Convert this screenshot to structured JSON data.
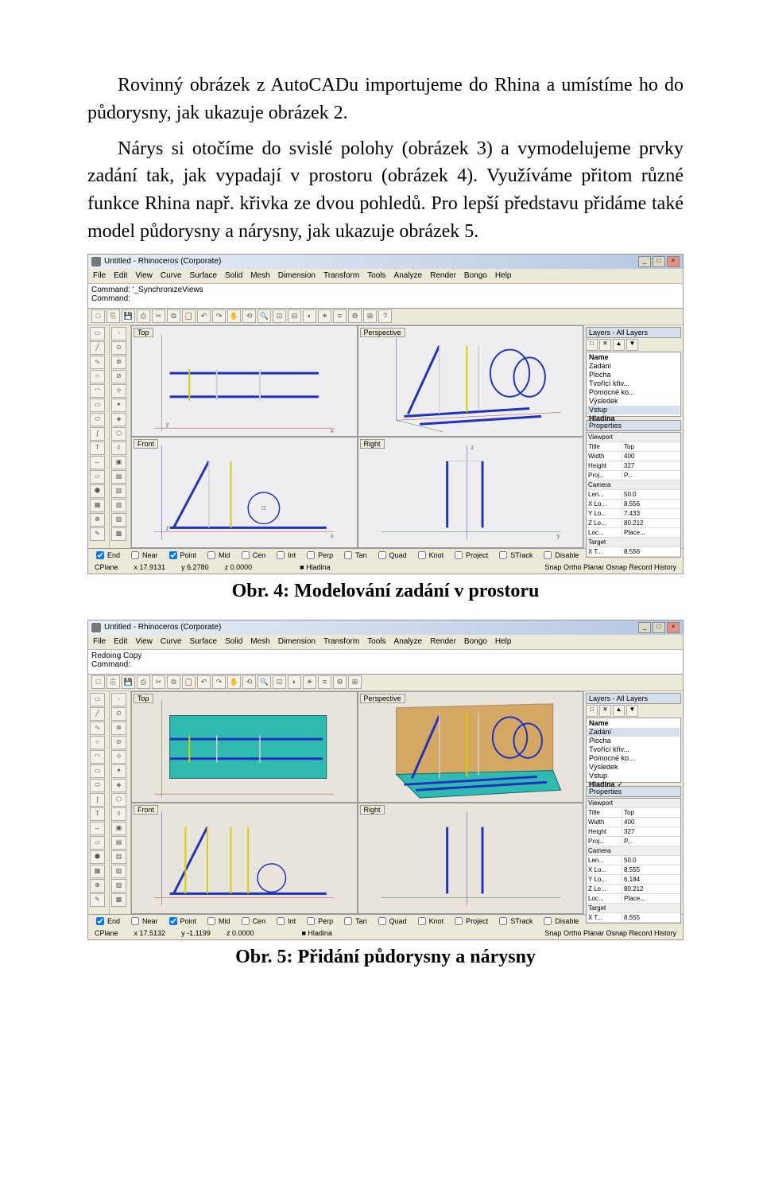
{
  "para1": "Rovinný obrázek z AutoCADu importujeme do Rhina a umístíme ho do půdorysny, jak ukazuje obrázek 2.",
  "para2": "Nárys si otočíme do svislé polohy (obrázek 3) a vymodelujeme prvky zadání tak, jak vypadají v prostoru (obrázek 4). Využíváme přitom různé funkce Rhina např. křivka ze dvou pohledů. Pro lepší představu přidáme také model půdorysny a nárysny, jak ukazuje obrázek 5.",
  "caption1": "Obr. 4: Modelování zadání v prostoru",
  "caption2": "Obr. 5: Přidání půdorysny a nárysny",
  "app": {
    "title": "Untitled - Rhinoceros (Corporate)"
  },
  "menu": [
    "File",
    "Edit",
    "View",
    "Curve",
    "Surface",
    "Solid",
    "Mesh",
    "Dimension",
    "Transform",
    "Tools",
    "Analyze",
    "Render",
    "Bongo",
    "Help"
  ],
  "cmd1": {
    "l1": "Command: '_SynchronizeViews",
    "l2": "Command:"
  },
  "cmd2": {
    "l1": "Redoing Copy",
    "l2": "Command:"
  },
  "views": {
    "top": "Top",
    "persp": "Perspective",
    "front": "Front",
    "right": "Right"
  },
  "layers": {
    "title": "Layers - All Layers",
    "nameH": "Name",
    "items": [
      {
        "n": "Zadání",
        "c": "#2040d0"
      },
      {
        "n": "Plocha",
        "c": "#2040d0"
      },
      {
        "n": "Tvořící křiv...",
        "c": "#2040d0"
      },
      {
        "n": "Pomocné ko...",
        "c": "#2040d0"
      },
      {
        "n": "Výsledek",
        "c": "#2040d0"
      },
      {
        "n": "Vstup",
        "c": "#909090"
      },
      {
        "n": "Hladina",
        "c": "#000000"
      }
    ]
  },
  "props1": {
    "title": "Properties",
    "vp": "Viewport",
    "rows": [
      [
        "Title",
        "Top"
      ],
      [
        "Width",
        "400"
      ],
      [
        "Height",
        "327"
      ],
      [
        "Proj...",
        "P..."
      ]
    ],
    "cam": "Camera",
    "camrows": [
      [
        "Len...",
        "50.0"
      ],
      [
        "X Lo...",
        "8.556"
      ],
      [
        "Y Lo...",
        "7.433"
      ],
      [
        "Z Lo...",
        "80.212"
      ],
      [
        "Loc...",
        "Place..."
      ]
    ],
    "tgt": "Target",
    "tgtrows": [
      [
        "X T...",
        "8.556"
      ]
    ]
  },
  "props2": {
    "rows": [
      [
        "Title",
        "Top"
      ],
      [
        "Width",
        "400"
      ],
      [
        "Height",
        "327"
      ],
      [
        "Proj...",
        "P..."
      ]
    ],
    "camrows": [
      [
        "Len...",
        "50.0"
      ],
      [
        "X Lo...",
        "8.555"
      ],
      [
        "Y Lo...",
        "6.184"
      ],
      [
        "Z Lo...",
        "80.212"
      ],
      [
        "Loc...",
        "Place..."
      ]
    ],
    "tgtrows": [
      [
        "X T...",
        "8.555"
      ]
    ]
  },
  "osnap": [
    "End",
    "Near",
    "Point",
    "Mid",
    "Cen",
    "Int",
    "Perp",
    "Tan",
    "Quad",
    "Knot",
    "Project",
    "STrack",
    "Disable"
  ],
  "cplane1": {
    "x": "x 17.9131",
    "y": "y 6.2780",
    "z": "z 0.0000",
    "h": "Hladina",
    "r": "Snap   Ortho   Planar   Osnap      Record History"
  },
  "cplane2": {
    "x": "x 17.5132",
    "y": "y -1.1199",
    "z": "z 0.0000",
    "h": "Hladina",
    "r": "Snap   Ortho   Planar   Osnap      Record History"
  },
  "cplabel": "CPlane"
}
